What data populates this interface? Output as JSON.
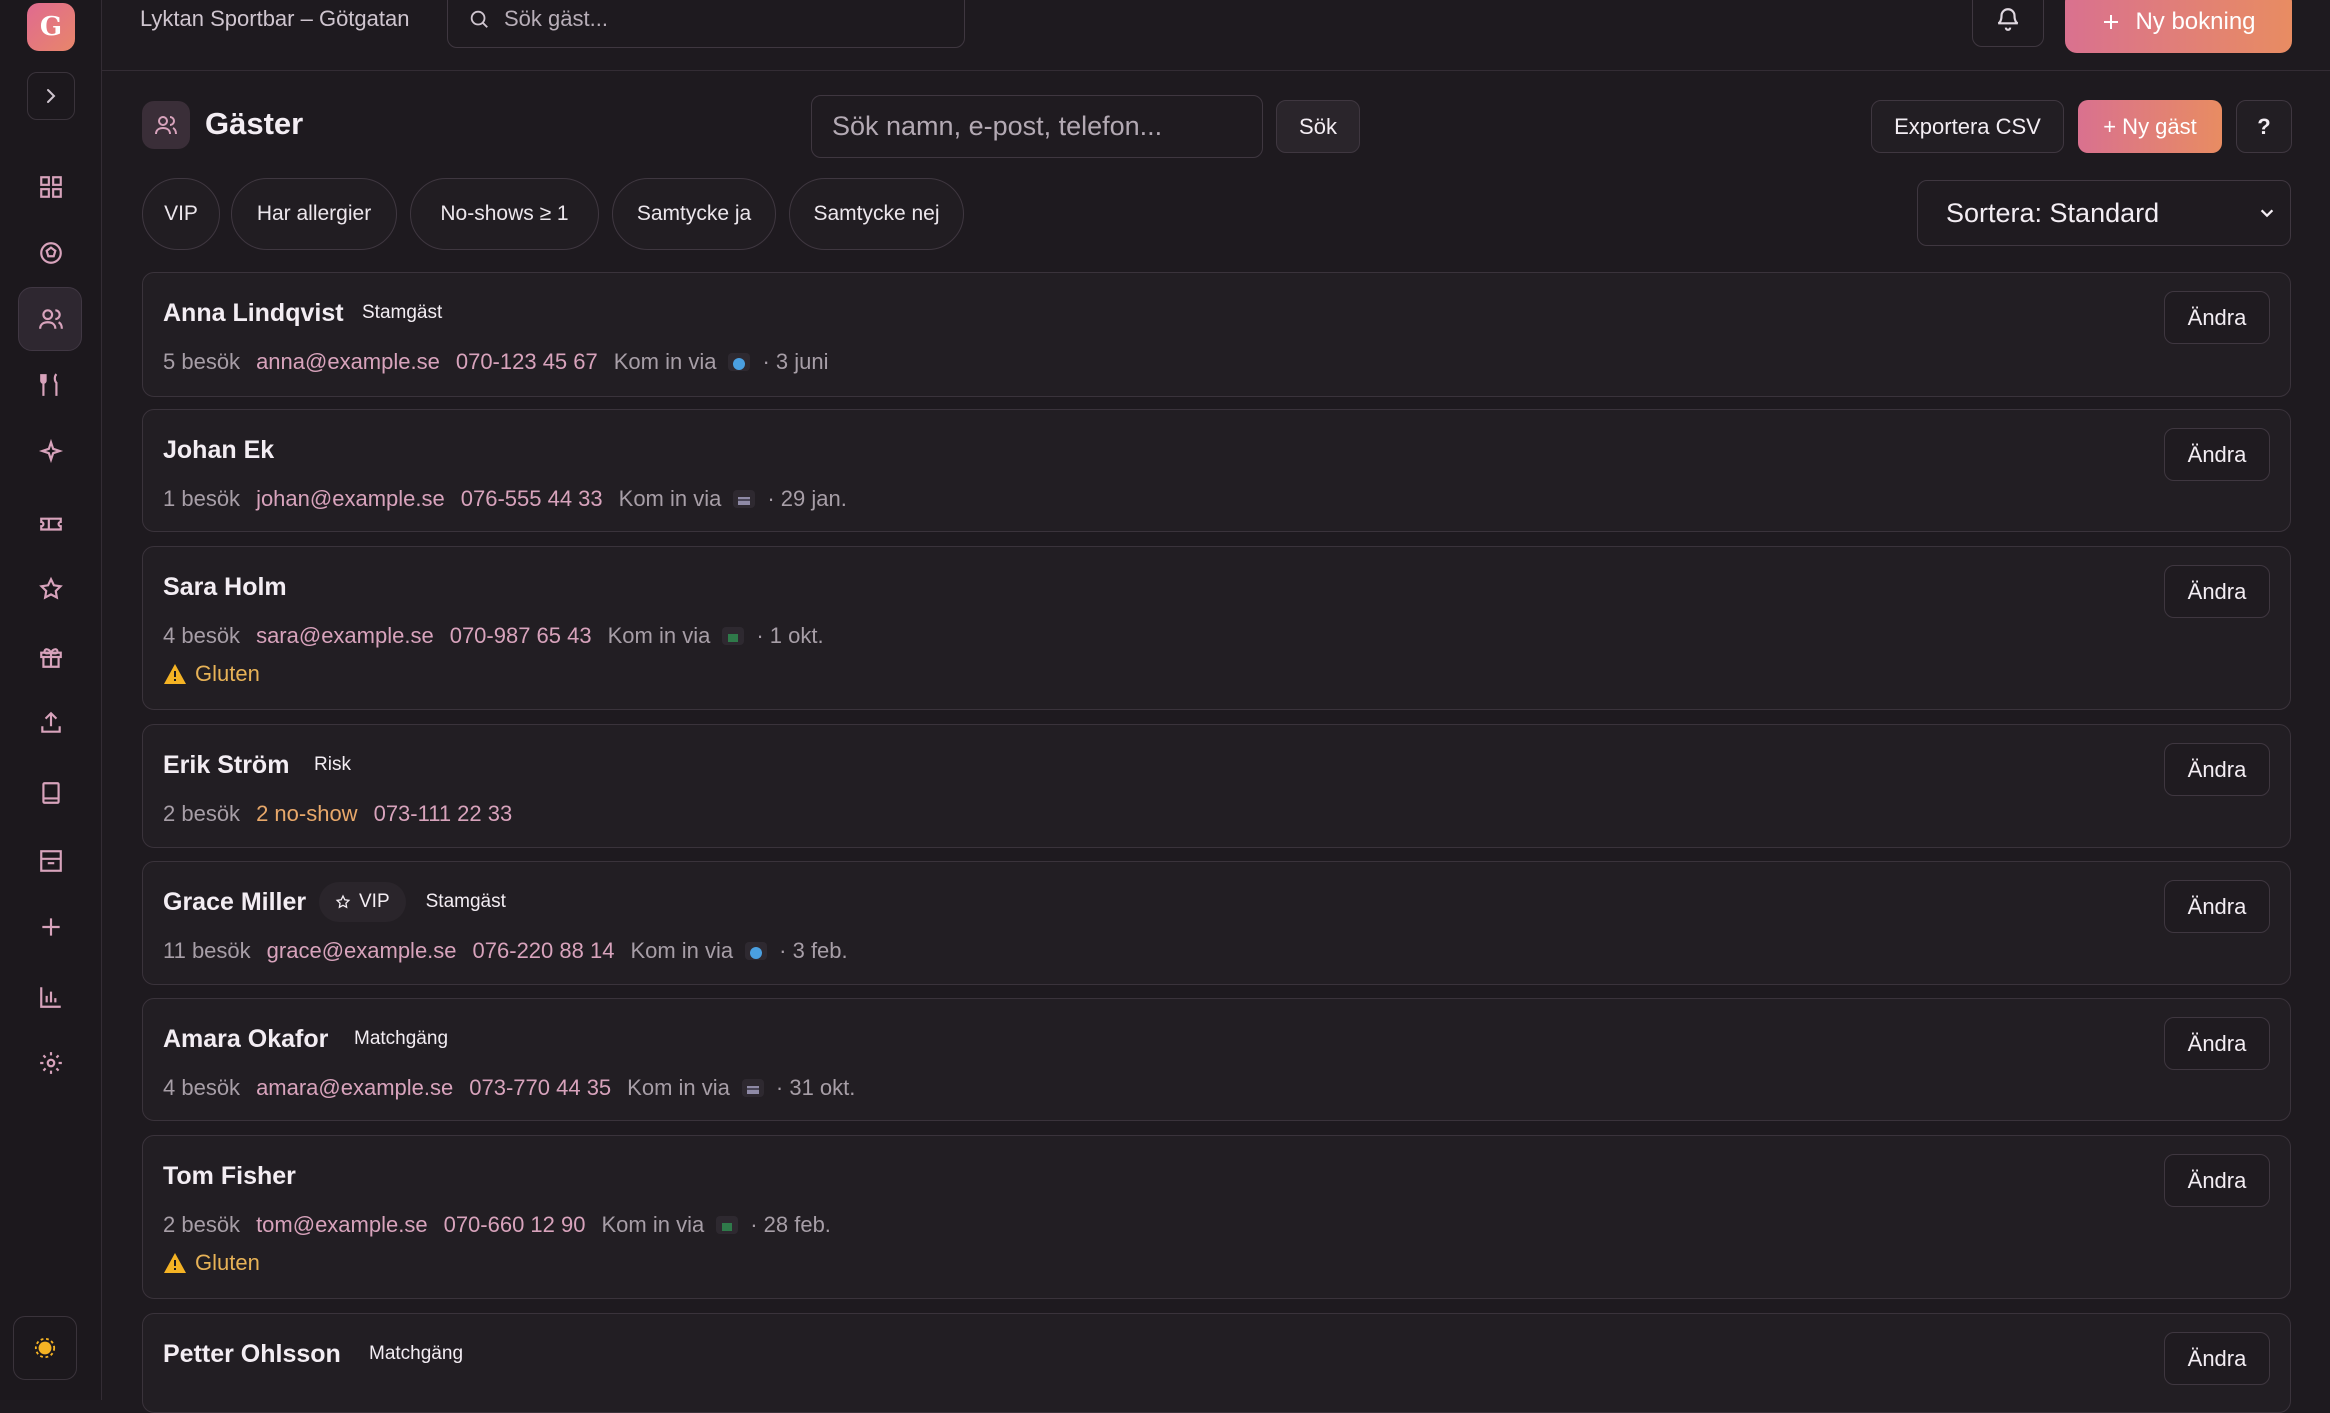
{
  "app": {
    "logo_letter": "G",
    "venue": "Lyktan Sportbar – Götgatan",
    "search_placeholder": "Sök gäst...",
    "new_booking": "Ny bokning"
  },
  "page": {
    "title": "Gäster",
    "search_placeholder": "Sök namn, e-post, telefon...",
    "search_button": "Sök",
    "export": "Exportera CSV",
    "new_guest": "+ Ny gäst",
    "help": "?",
    "sort": "Sortera: Standard"
  },
  "filters": [
    "VIP",
    "Har allergier",
    "No-shows ≥ 1",
    "Samtycke ja",
    "Samtycke nej"
  ],
  "guests": [
    {
      "name": "Anna Lindqvist",
      "tag": "Stamgäst",
      "visits": "5 besök",
      "email": "anna@example.se",
      "phone": "070-123 45 67",
      "via": "Kom in via",
      "source": "web",
      "date": "· 3 juni"
    },
    {
      "name": "Johan Ek",
      "visits": "1 besök",
      "email": "johan@example.se",
      "phone": "076-555 44 33",
      "via": "Kom in via",
      "source": "card",
      "date": "· 29 jan."
    },
    {
      "name": "Sara Holm",
      "visits": "4 besök",
      "email": "sara@example.se",
      "phone": "070-987 65 43",
      "via": "Kom in via",
      "source": "walk-in",
      "date": "· 1 okt.",
      "allergy": "Gluten"
    },
    {
      "name": "Erik Ström",
      "tag": "Risk",
      "visits": "2 besök",
      "noshow": "2 no-show",
      "phone": "073-111 22 33"
    },
    {
      "name": "Grace Miller",
      "vip": "VIP",
      "tag": "Stamgäst",
      "visits": "11 besök",
      "email": "grace@example.se",
      "phone": "076-220 88 14",
      "via": "Kom in via",
      "source": "web",
      "date": "· 3 feb."
    },
    {
      "name": "Amara Okafor",
      "tag": "Matchgäng",
      "visits": "4 besök",
      "email": "amara@example.se",
      "phone": "073-770 44 35",
      "via": "Kom in via",
      "source": "card",
      "date": "· 31 okt."
    },
    {
      "name": "Tom Fisher",
      "visits": "2 besök",
      "email": "tom@example.se",
      "phone": "070-660 12 90",
      "via": "Kom in via",
      "source": "walk-in",
      "date": "· 28 feb.",
      "allergy": "Gluten"
    },
    {
      "name": "Petter Ohlsson",
      "tag": "Matchgäng"
    }
  ],
  "edit_label": "Ändra"
}
